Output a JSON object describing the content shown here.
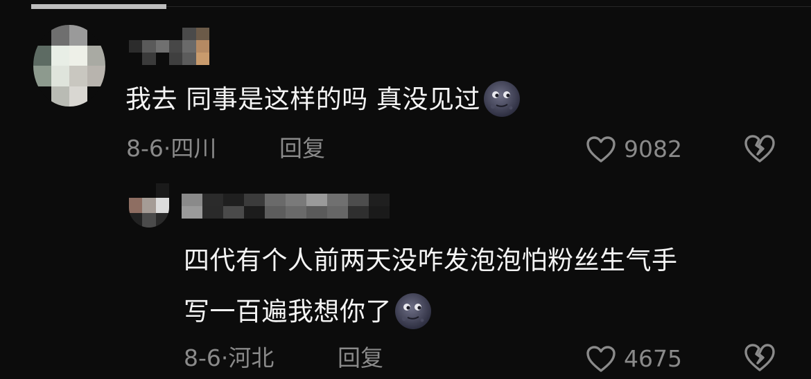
{
  "comments": [
    {
      "text": "我去 同事是这样的吗 真没见过",
      "emoji": "new-moon-face-emoji",
      "date_location": "8-6·四川",
      "reply_label": "回复",
      "like_count": "9082"
    },
    {
      "text_line1": "四代有个人前两天没咋发泡泡怕粉丝生气手",
      "text_line2": "写一百遍我想你了",
      "emoji": "new-moon-face-emoji",
      "date_location": "8-6·河北",
      "reply_label": "回复",
      "like_count": "4675"
    }
  ],
  "colors": {
    "background": "#0c0c0c",
    "text": "#f4f4f4",
    "meta": "#8a8a8a"
  }
}
